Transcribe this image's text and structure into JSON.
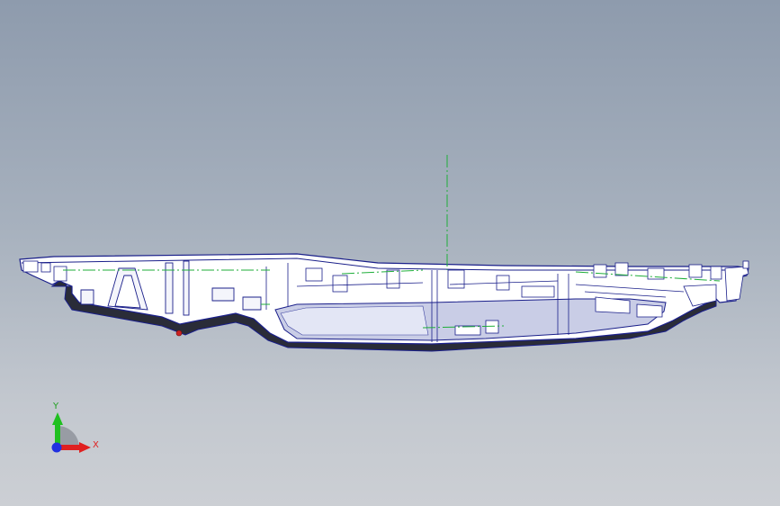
{
  "viewport": {
    "background_top": "#8e9bad",
    "background_bottom": "#cccfd4"
  },
  "model": {
    "edge_color": "#1a1f8a",
    "face_color": "#ffffff",
    "shade_color": "#c9cde6",
    "dark_color": "#2a2c38",
    "centerline_color": "#1fae3a",
    "marker_color": "#cc2222"
  },
  "triad": {
    "x_label": "X",
    "y_label": "Y",
    "x_color": "#e02020",
    "y_color": "#20c020",
    "z_color": "#2030e0",
    "label_x_color": "#e02020",
    "label_y_color": "#20a020"
  }
}
